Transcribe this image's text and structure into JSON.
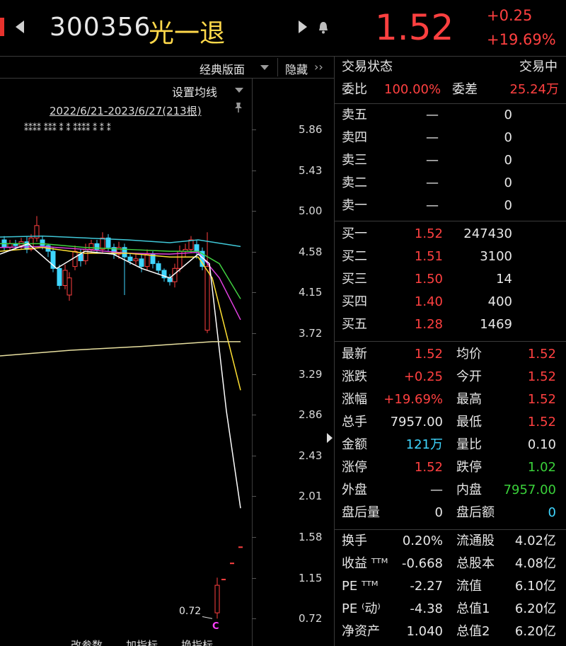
{
  "header": {
    "code": "300356",
    "name": "光一退",
    "price": "1.52",
    "change": "+0.25",
    "change_pct": "+19.69%"
  },
  "toolbar": {
    "classic_layout": "经典版面",
    "hide": "隐藏",
    "hide_arrows": "››",
    "set_ma": "设置均线",
    "date_range": "2022/6/21-2023/6/27(213根)"
  },
  "axis": {
    "ticks": [
      "5.86",
      "5.43",
      "5.00",
      "4.58",
      "4.15",
      "3.72",
      "3.29",
      "2.86",
      "2.43",
      "2.01",
      "1.58",
      "1.15",
      "0.72"
    ]
  },
  "chart_annot": {
    "low_label": "0.72",
    "c_marker": "C"
  },
  "bottom_tabs": [
    "改参数",
    "加指标",
    "换指标"
  ],
  "status": {
    "label": "交易状态",
    "value": "交易中"
  },
  "weibi": {
    "label": "委比",
    "value": "100.00%",
    "diff_label": "委差",
    "diff_value": "25.24万"
  },
  "asks": [
    {
      "label": "卖五",
      "price": "—",
      "vol": "0"
    },
    {
      "label": "卖四",
      "price": "—",
      "vol": "0"
    },
    {
      "label": "卖三",
      "price": "—",
      "vol": "0"
    },
    {
      "label": "卖二",
      "price": "—",
      "vol": "0"
    },
    {
      "label": "卖一",
      "price": "—",
      "vol": "0"
    }
  ],
  "bids": [
    {
      "label": "买一",
      "price": "1.52",
      "vol": "247430"
    },
    {
      "label": "买二",
      "price": "1.51",
      "vol": "3100"
    },
    {
      "label": "买三",
      "price": "1.50",
      "vol": "14"
    },
    {
      "label": "买四",
      "price": "1.40",
      "vol": "400"
    },
    {
      "label": "买五",
      "price": "1.28",
      "vol": "1469"
    }
  ],
  "stats": [
    {
      "l1": "最新",
      "v1": "1.52",
      "c1": "red",
      "l2": "均价",
      "v2": "1.52",
      "c2": "red"
    },
    {
      "l1": "涨跌",
      "v1": "+0.25",
      "c1": "red",
      "l2": "今开",
      "v2": "1.52",
      "c2": "red"
    },
    {
      "l1": "涨幅",
      "v1": "+19.69%",
      "c1": "red",
      "l2": "最高",
      "v2": "1.52",
      "c2": "red"
    },
    {
      "l1": "总手",
      "v1": "7957.00",
      "c1": "white",
      "l2": "最低",
      "v2": "1.52",
      "c2": "red"
    },
    {
      "l1": "金额",
      "v1": "121万",
      "c1": "cyan",
      "l2": "量比",
      "v2": "0.10",
      "c2": "white"
    },
    {
      "l1": "涨停",
      "v1": "1.52",
      "c1": "red",
      "l2": "跌停",
      "v2": "1.02",
      "c2": "green"
    },
    {
      "l1": "外盘",
      "v1": "—",
      "c1": "white",
      "l2": "内盘",
      "v2": "7957.00",
      "c2": "green"
    },
    {
      "l1": "盘后量",
      "v1": "0",
      "c1": "white",
      "l2": "盘后额",
      "v2": "0",
      "c2": "cyan"
    }
  ],
  "fundamentals": [
    {
      "l1": "换手",
      "v1": "0.20%",
      "l2": "流通股",
      "v2": "4.02亿"
    },
    {
      "l1": "收益 ᵀᵀᴹ",
      "v1": "-0.668",
      "l2": "总股本",
      "v2": "4.08亿"
    },
    {
      "l1": "PE ᵀᵀᴹ",
      "v1": "-2.27",
      "l2": "流值",
      "v2": "6.10亿"
    },
    {
      "l1": "PE ⁽动⁾",
      "v1": "-4.38",
      "l2": "总值1",
      "v2": "6.20亿"
    },
    {
      "l1": "净资产",
      "v1": "1.040",
      "l2": "总值2",
      "v2": "6.20亿"
    }
  ],
  "colors": {
    "up": "#ff4040",
    "down": "#3fd6ff",
    "ma5": "#ffffff",
    "ma10": "#ffe033",
    "ma20": "#e040e0",
    "ma30": "#40d040",
    "ma60": "#40c8d8",
    "ma250": "#e8e0a0"
  }
}
